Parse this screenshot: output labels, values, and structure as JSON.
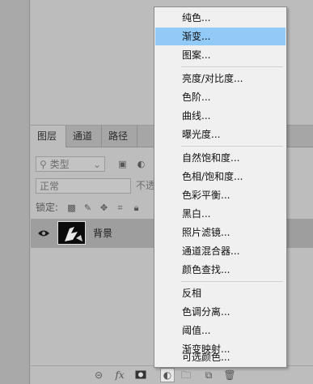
{
  "layers_panel": {
    "tabs": [
      "图层",
      "通道",
      "路径"
    ],
    "filter_kind": "类型",
    "blend_mode": "正常",
    "opacity_label": "不透",
    "lock_label": "锁定:",
    "layer": {
      "name": "背景"
    }
  },
  "menu": {
    "groups": [
      [
        "纯色...",
        "渐变...",
        "图案..."
      ],
      [
        "亮度/对比度...",
        "色阶...",
        "曲线...",
        "曝光度..."
      ],
      [
        "自然饱和度...",
        "色相/饱和度...",
        "色彩平衡...",
        "黑白...",
        "照片滤镜...",
        "通道混合器...",
        "颜色查找..."
      ],
      [
        "反相",
        "色调分离...",
        "阈值...",
        "渐变映射...",
        "可选颜色..."
      ]
    ],
    "highlighted": "渐变...",
    "highlight_color": "#91c9f7"
  },
  "bottom_bar": {
    "fx_label": "fx",
    "icons": [
      "link-icon",
      "fx-icon",
      "mask-icon",
      "adjustment-layer-icon",
      "folder-icon",
      "new-layer-icon",
      "trash-icon"
    ]
  }
}
